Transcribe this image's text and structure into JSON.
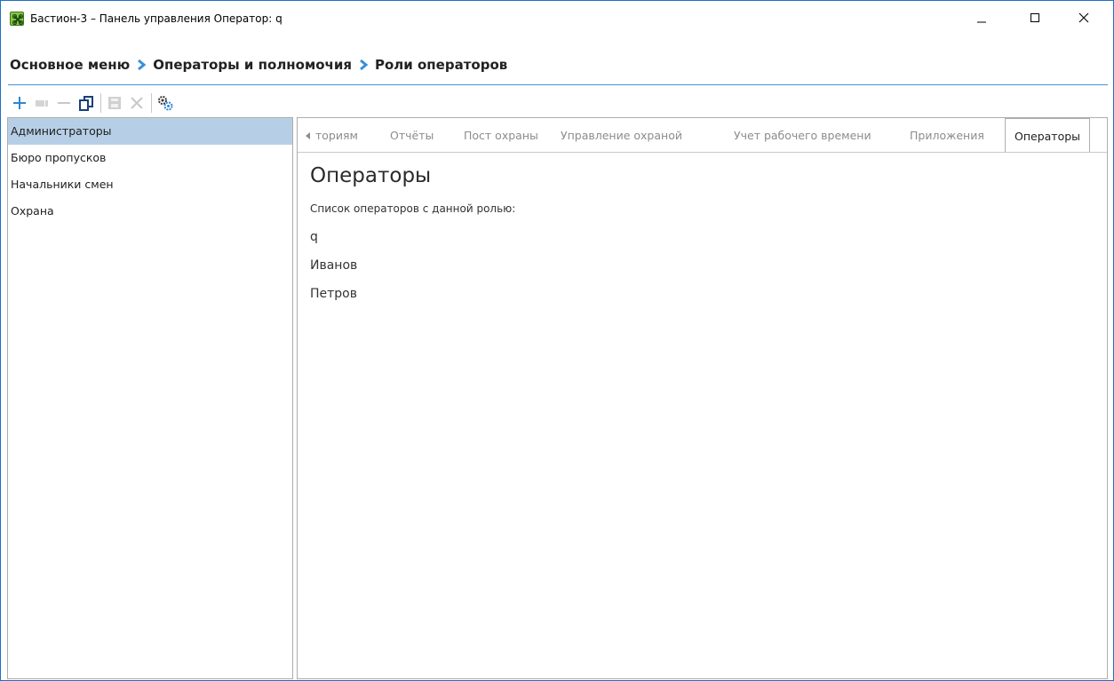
{
  "window": {
    "title": "Бастион-3 – Панель управления Оператор: q",
    "accent_color": "#1f6fc5"
  },
  "breadcrumb": {
    "items": [
      "Основное меню",
      "Операторы и полномочия",
      "Роли операторов"
    ],
    "separator_icon": "chevron-right-icon",
    "separator_color": "#3a8fd6"
  },
  "toolbar": {
    "buttons": [
      {
        "icon": "plus-icon",
        "enabled": true
      },
      {
        "icon": "edit-icon",
        "enabled": false
      },
      {
        "icon": "minus-icon",
        "enabled": false
      },
      {
        "icon": "copy-icon",
        "enabled": true
      },
      {
        "icon": "save-icon",
        "enabled": false
      },
      {
        "icon": "cancel-icon",
        "enabled": false
      },
      {
        "icon": "settings-gear-icon",
        "enabled": true
      }
    ]
  },
  "roles": {
    "items": [
      {
        "label": "Администраторы",
        "selected": true
      },
      {
        "label": "Бюро пропусков",
        "selected": false
      },
      {
        "label": "Начальники смен",
        "selected": false
      },
      {
        "label": "Охрана",
        "selected": false
      }
    ],
    "selected_color": "#b7cfe6"
  },
  "tabs": {
    "items": [
      {
        "label": "ториям",
        "active": false
      },
      {
        "label": "Отчёты",
        "active": false
      },
      {
        "label": "Пост охраны",
        "active": false
      },
      {
        "label": "Управление охраной",
        "active": false
      },
      {
        "label": "Учет рабочего времени",
        "active": false
      },
      {
        "label": "Приложения",
        "active": false
      },
      {
        "label": "Операторы",
        "active": true
      }
    ]
  },
  "content": {
    "heading": "Операторы",
    "subtitle": "Список операторов с данной ролью:",
    "operators": [
      "q",
      "Иванов",
      "Петров"
    ]
  }
}
